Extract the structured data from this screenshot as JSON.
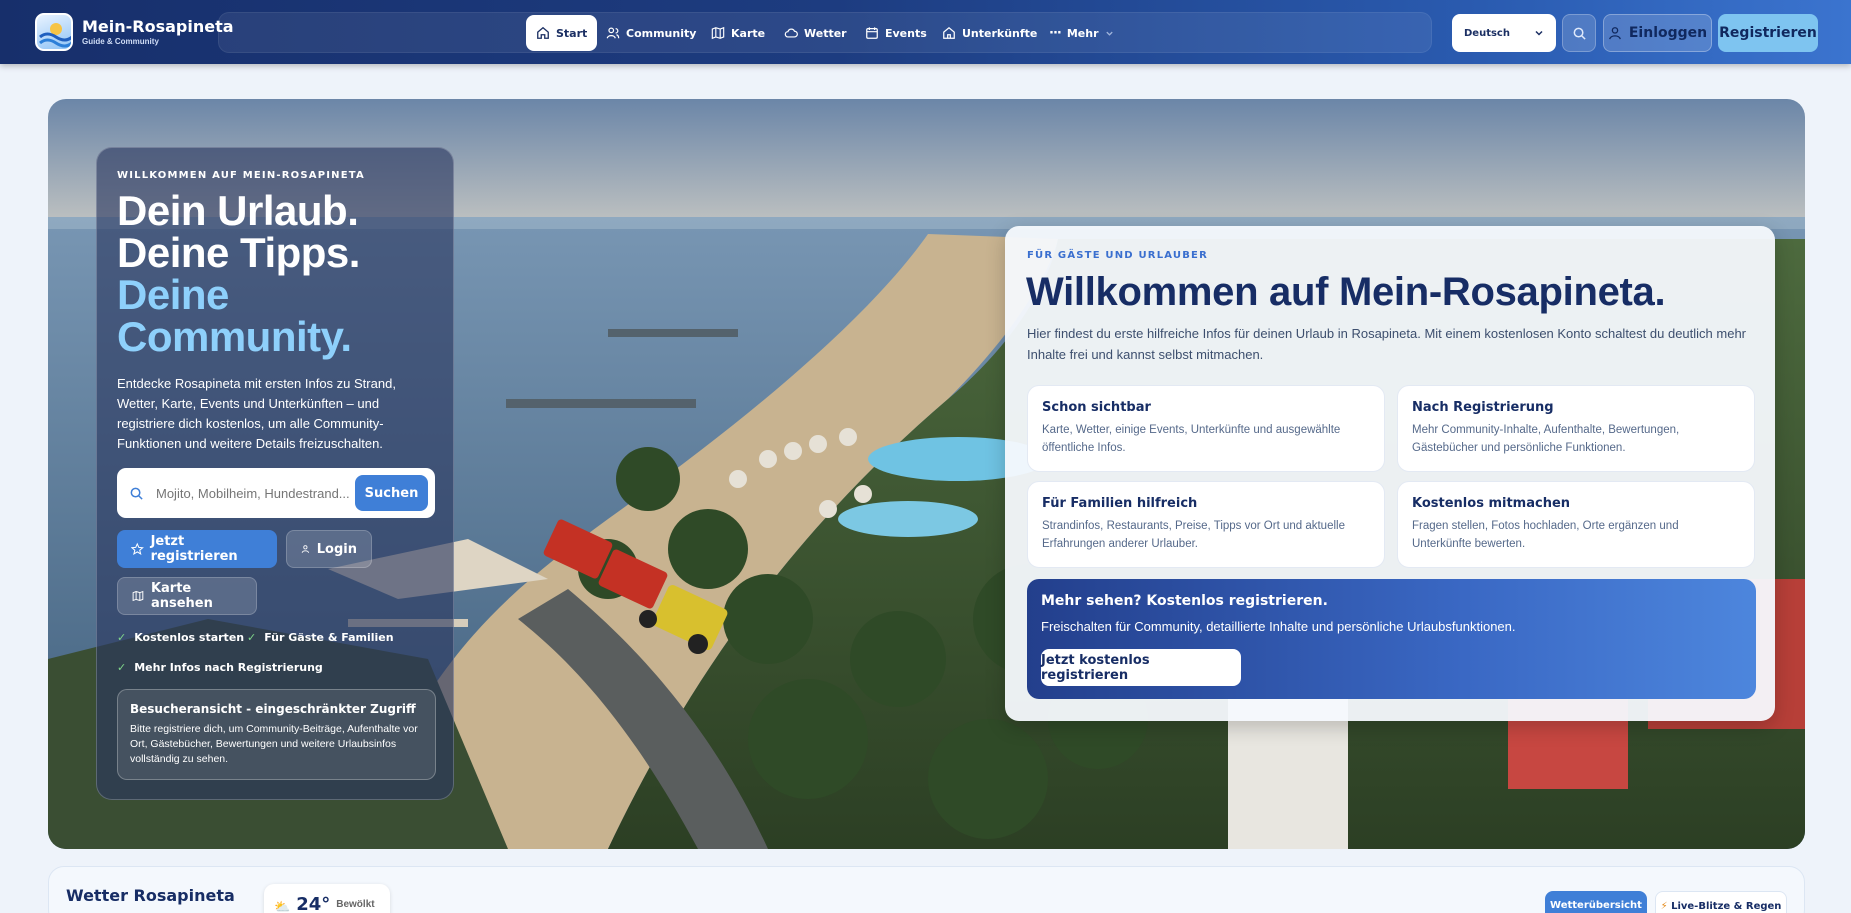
{
  "brand": {
    "name": "Mein-Rosapineta",
    "tagline": "Guide & Community"
  },
  "nav": {
    "items": [
      {
        "label": "Start",
        "icon": "home-icon",
        "active": true
      },
      {
        "label": "Community",
        "icon": "users-icon"
      },
      {
        "label": "Karte",
        "icon": "map-icon"
      },
      {
        "label": "Wetter",
        "icon": "cloud-icon"
      },
      {
        "label": "Events",
        "icon": "calendar-icon"
      },
      {
        "label": "Unterkünfte",
        "icon": "house-icon"
      },
      {
        "label": "Mehr",
        "icon": "more-icon"
      }
    ],
    "language": "Deutsch",
    "login_label": "Einloggen",
    "register_label": "Registrieren"
  },
  "hero": {
    "eyebrow": "WILLKOMMEN AUF MEIN-ROSAPINETA",
    "headline_line1": "Dein Urlaub.",
    "headline_line2": "Deine Tipps.",
    "headline_line3": "Deine",
    "headline_line4": "Community.",
    "lead": "Entdecke Rosapineta mit ersten Infos zu Strand, Wetter, Karte, Events und Unterkünften – und registriere dich kostenlos, um alle Community-Funktionen und weitere Details freizuschalten.",
    "search_placeholder": "Mojito, Mobilheim, Hundestrand...",
    "search_button": "Suchen",
    "register_button": "Jetzt registrieren",
    "login_button": "Login",
    "map_button": "Karte ansehen",
    "checks": [
      "Kostenlos starten",
      "Für Gäste & Familien",
      "Mehr Infos nach Registrierung"
    ],
    "notice_title": "Besucheransicht - eingeschränkter Zugriff",
    "notice_body": "Bitte registriere dich, um Community-Beiträge, Aufenthalte vor Ort, Gästebücher, Bewertungen und weitere Urlaubsinfos vollständig zu sehen."
  },
  "welcome": {
    "eyebrow": "FÜR GÄSTE UND URLAUBER",
    "title": "Willkommen auf Mein-Rosapineta.",
    "lead": "Hier findest du erste hilfreiche Infos für deinen Urlaub in Rosapineta. Mit einem kostenlosen Konto schaltest du deutlich mehr Inhalte frei und kannst selbst mitmachen.",
    "tiles": [
      {
        "title": "Schon sichtbar",
        "body": "Karte, Wetter, einige Events, Unterkünfte und ausgewählte öffentliche Infos."
      },
      {
        "title": "Nach Registrierung",
        "body": "Mehr Community-Inhalte, Aufenthalte, Bewertungen, Gästebücher und persönliche Funktionen."
      },
      {
        "title": "Für Familien hilfreich",
        "body": "Strandinfos, Restaurants, Preise, Tipps vor Ort und aktuelle Erfahrungen anderer Urlauber."
      },
      {
        "title": "Kostenlos mitmachen",
        "body": "Fragen stellen, Fotos hochladen, Orte ergänzen und Unterkünfte bewerten."
      }
    ],
    "cta_title": "Mehr sehen? Kostenlos registrieren.",
    "cta_body": "Freischalten für Community, detaillierte Inhalte und persönliche Urlaubsfunktionen.",
    "cta_button": "Jetzt kostenlos registrieren"
  },
  "weather": {
    "title": "Wetter Rosapineta",
    "temp": "24°",
    "desc": "Bewölkt",
    "tab1": "Wetterübersicht",
    "tab2": "Live-Blitze & Regen"
  },
  "colors": {
    "nav_dark": "#172f6b",
    "accent": "#3f7fd7",
    "headline_blue": "#8ed0fb",
    "title_navy": "#172d65"
  }
}
